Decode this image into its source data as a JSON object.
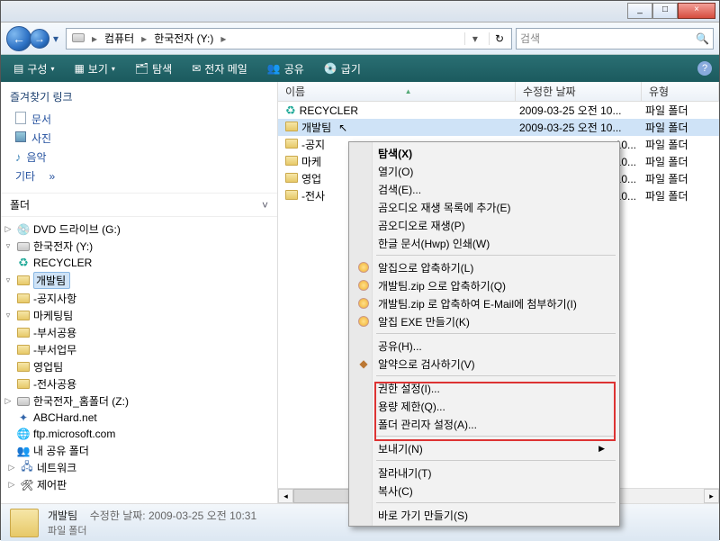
{
  "titlebar": {
    "min": "_",
    "max": "□",
    "close": "×"
  },
  "nav": {
    "back_glyph": "←",
    "fwd_glyph": "→",
    "drop_glyph": "▾",
    "crumb_computer": "컴퓨터",
    "crumb_drive": "한국전자 (Y:)",
    "sep": "▸",
    "addr_drop": "▾",
    "refresh": "↻"
  },
  "search": {
    "placeholder": "검색",
    "mag": "🔍"
  },
  "toolbar": {
    "organize": "구성",
    "views": "보기",
    "explore": "탐색",
    "email": "전자 메일",
    "share": "공유",
    "burn": "굽기",
    "dd": "▾",
    "help": "?"
  },
  "left": {
    "fav_header": "즐겨찾기 링크",
    "docs": "문서",
    "pics": "사진",
    "music": "음악",
    "etc": "기타",
    "etc_arrow": "»",
    "folders_header": "폴더",
    "chev": "˅"
  },
  "tree": {
    "dvd": "DVD 드라이브 (G:)",
    "drive": "한국전자 (Y:)",
    "recycler": "RECYCLER",
    "dev": "개발팀",
    "notice": "-공지사항",
    "marketing": "마케팅팀",
    "deptshare": "-부서공용",
    "deptwork": "-부서업무",
    "sales": "영업팀",
    "allshare": "-전사공용",
    "zdrive": "한국전자_홈폴더 (Z:)",
    "abchard": "ABCHard.net",
    "ftp": "ftp.microsoft.com",
    "mycomp": "내 공유 폴더",
    "network": "네트워크",
    "control": "제어판"
  },
  "cols": {
    "name": "이름",
    "date": "수정한 날짜",
    "type": "유형",
    "sort": "▲"
  },
  "files": [
    {
      "name": "RECYCLER",
      "date": "2009-03-25 오전 10...",
      "type": "파일 폴더",
      "icon": "recycle"
    },
    {
      "name": "개발팀",
      "date": "2009-03-25 오전 10...",
      "type": "파일 폴더",
      "icon": "folder"
    },
    {
      "name": "-공지",
      "date": "",
      "date_tail": "10...",
      "type": "파일 폴더",
      "icon": "folder"
    },
    {
      "name": "마케",
      "date": "",
      "date_tail": "10...",
      "type": "파일 폴더",
      "icon": "folder"
    },
    {
      "name": "영업",
      "date": "",
      "date_tail": "10...",
      "type": "파일 폴더",
      "icon": "folder"
    },
    {
      "name": "-전사",
      "date": "",
      "date_tail": "10...",
      "type": "파일 폴더",
      "icon": "folder"
    }
  ],
  "ctx": {
    "explore": "탐색(X)",
    "open": "열기(O)",
    "search": "검색(E)...",
    "gom_add": "곰오디오 재생 목록에 추가(E)",
    "gom_play": "곰오디오로 재생(P)",
    "hwp_print": "한글 문서(Hwp) 인쇄(W)",
    "alzip": "알집으로 압축하기(L)",
    "alzip_zip": "개발팀.zip 으로 압축하기(Q)",
    "alzip_mail": "개발팀.zip 로 압축하여 E-Mail에 첨부하기(I)",
    "alzip_exe": "알집 EXE 만들기(K)",
    "share": "공유(H)...",
    "alyac": "알약으로 검사하기(V)",
    "perm": "권한 설정(I)...",
    "quota": "용량 제한(Q)...",
    "admin": "폴더 관리자 설정(A)...",
    "send": "보내기(N)",
    "cut": "잘라내기(T)",
    "copy": "복사(C)",
    "shortcut": "바로 가기 만들기(S)",
    "sub": "▶"
  },
  "status": {
    "name": "개발팀",
    "type": "파일 폴더",
    "date_label": "수정한 날짜:",
    "date_value": "2009-03-25 오전 10:31"
  }
}
